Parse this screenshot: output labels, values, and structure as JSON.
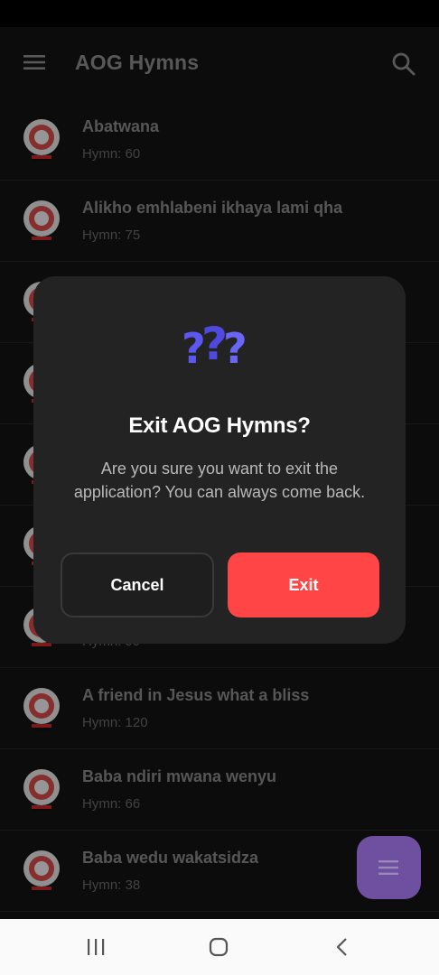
{
  "app_bar": {
    "title": "AOG Hymns",
    "menu_icon": "hamburger-menu-icon",
    "search_icon": "search-icon"
  },
  "hymns": [
    {
      "name": "Abatwana",
      "sub": "Hymn: 60"
    },
    {
      "name": "Alikho emhlabeni ikhaya lami qha",
      "sub": "Hymn: 75"
    },
    {
      "name": "",
      "sub": ""
    },
    {
      "name": "",
      "sub": ""
    },
    {
      "name": "",
      "sub": ""
    },
    {
      "name": "",
      "sub": ""
    },
    {
      "name": "",
      "sub": "Hymn: 99"
    },
    {
      "name": "A friend in Jesus what a bliss",
      "sub": "Hymn: 120"
    },
    {
      "name": "Baba ndiri mwana wenyu",
      "sub": "Hymn: 66"
    },
    {
      "name": "Baba wedu wakatsidza",
      "sub": "Hymn: 38"
    }
  ],
  "dialog": {
    "icon": "question-marks-icon",
    "title": "Exit AOG Hymns?",
    "message": "Are you sure you want to exit the application? You can always come back.",
    "cancel_label": "Cancel",
    "exit_label": "Exit"
  },
  "fab": {
    "icon": "menu-lines-icon"
  },
  "colors": {
    "background": "#141414",
    "dialog": "#232323",
    "exit_button": "#ff4545",
    "fab": "#6e4fa0",
    "icon_accent": "#5b57f0"
  },
  "nav": {
    "recents_icon": "recent-apps-icon",
    "home_icon": "home-icon",
    "back_icon": "back-icon"
  }
}
